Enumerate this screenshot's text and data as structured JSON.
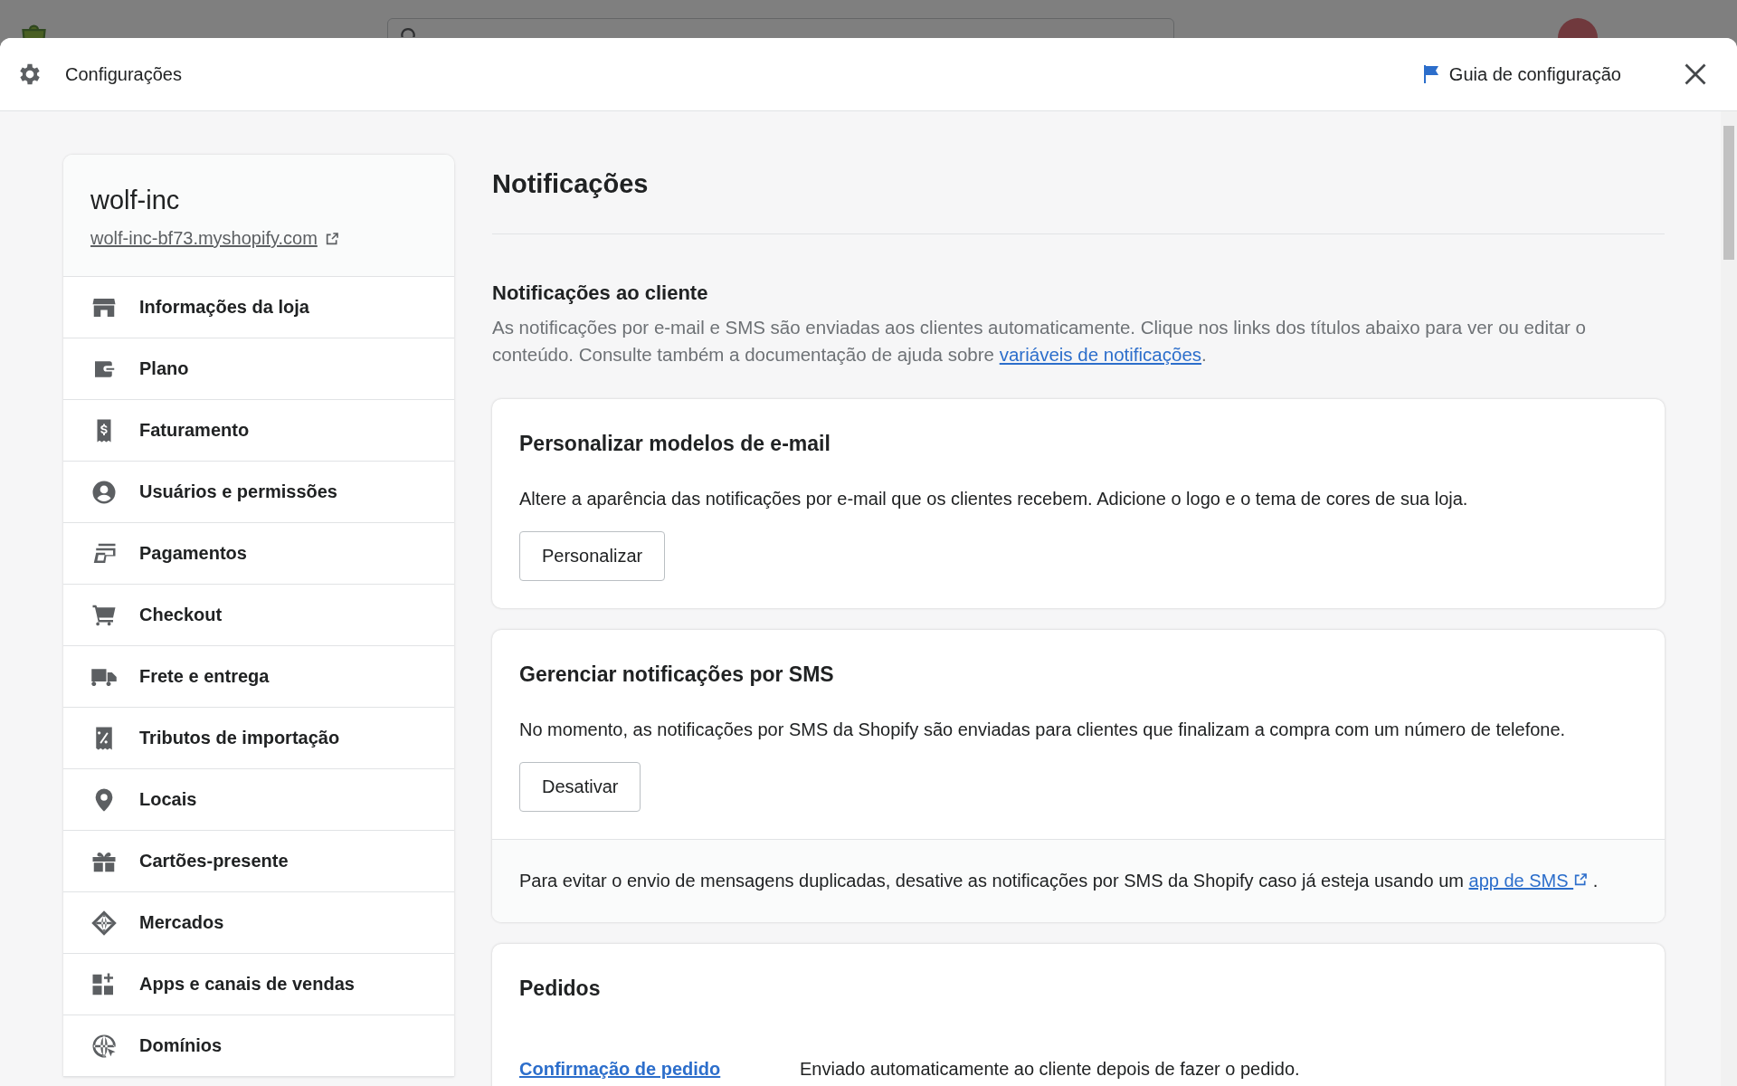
{
  "modal": {
    "title": "Configurações",
    "setup_guide": "Guia de configuração"
  },
  "sidebar": {
    "store_name": "wolf-inc",
    "store_url": "wolf-inc-bf73.myshopify.com",
    "items": [
      {
        "label": "Informações da loja"
      },
      {
        "label": "Plano"
      },
      {
        "label": "Faturamento"
      },
      {
        "label": "Usuários e permissões"
      },
      {
        "label": "Pagamentos"
      },
      {
        "label": "Checkout"
      },
      {
        "label": "Frete e entrega"
      },
      {
        "label": "Tributos de importação"
      },
      {
        "label": "Locais"
      },
      {
        "label": "Cartões-presente"
      },
      {
        "label": "Mercados"
      },
      {
        "label": "Apps e canais de vendas"
      },
      {
        "label": "Domínios"
      }
    ]
  },
  "page_title": "Notificações",
  "customer_notifications": {
    "title": "Notificações ao cliente",
    "description": "As notificações por e-mail e SMS são enviadas aos clientes automaticamente. Clique nos links dos títulos abaixo para ver ou editar o conteúdo. Consulte também a documentação de ajuda sobre ",
    "link": "variáveis de notificações",
    "after": "."
  },
  "cards": [
    {
      "title": "Personalizar modelos de e-mail",
      "text": "Altere a aparência das notificações por e-mail que os clientes recebem. Adicione o logo e o tema de cores de sua loja.",
      "button": "Personalizar"
    },
    {
      "title": "Gerenciar notificações por SMS",
      "text": "No momento, as notificações por SMS da Shopify são enviadas para clientes que finalizam a compra com um número de telefone.",
      "button": "Desativar",
      "footer": {
        "text": "Para evitar o envio de mensagens duplicadas, desative as notificações por SMS da Shopify caso já esteja usando um ",
        "link": "app de SMS",
        "after": " ."
      }
    }
  ],
  "orders": {
    "title": "Pedidos",
    "rows": [
      {
        "link": "Confirmação de pedido",
        "description": "Enviado automaticamente ao cliente depois de fazer o pedido."
      }
    ]
  }
}
